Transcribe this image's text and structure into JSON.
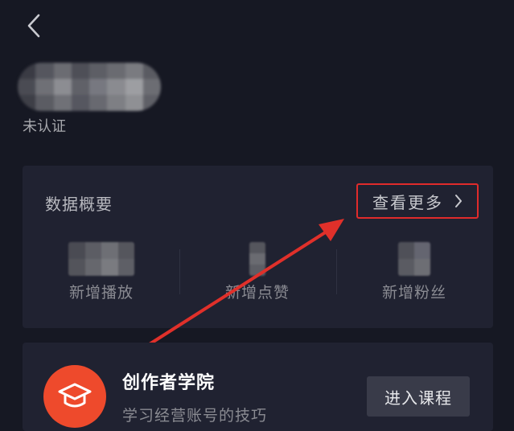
{
  "header": {
    "back_icon": "chevron-left-icon"
  },
  "profile": {
    "verify_status": "未认证"
  },
  "data_overview": {
    "title": "数据概要",
    "more_label": "查看更多",
    "more_icon": "chevron-right-icon",
    "highlight_color": "#e02b2b",
    "metrics": [
      {
        "label": "新增播放"
      },
      {
        "label": "新增点赞"
      },
      {
        "label": "新增粉丝"
      }
    ]
  },
  "academy": {
    "icon": "graduation-cap-icon",
    "title": "创作者学院",
    "subtitle": "学习经营账号的技巧",
    "button_label": "进入课程",
    "accent_color": "#ee4a2c"
  }
}
